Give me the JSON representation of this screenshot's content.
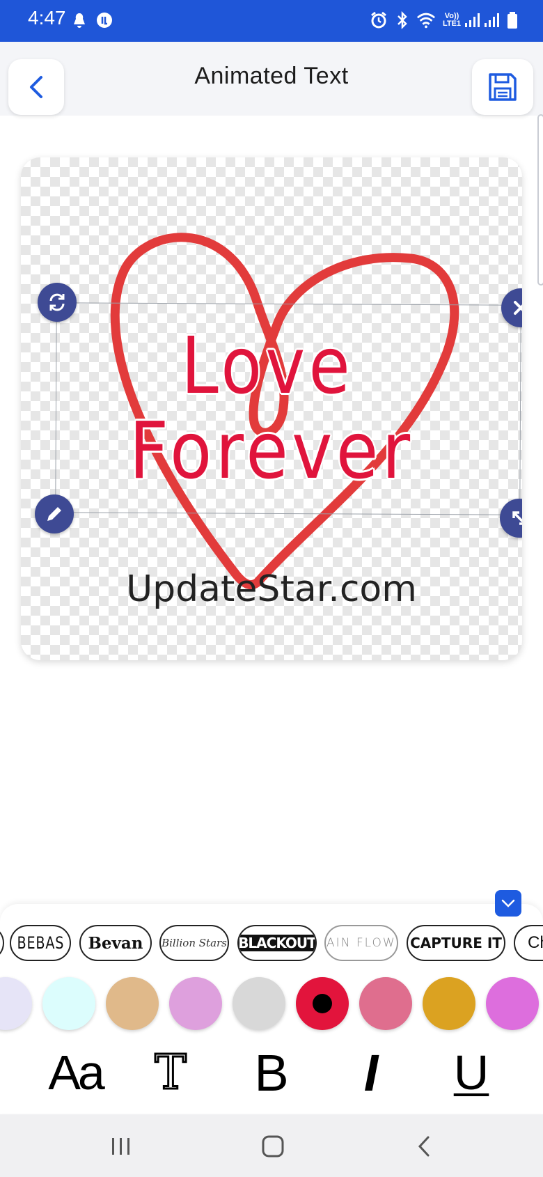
{
  "status_bar": {
    "time": "4:47",
    "network_label_top": "Vo))",
    "network_label_bottom": "LTE1",
    "icons": [
      "notification-icon",
      "messenger-icon",
      "alarm-icon",
      "bluetooth-icon",
      "wifi-icon",
      "signal-icon",
      "signal-icon",
      "battery-icon"
    ]
  },
  "header": {
    "title": "Animated Text",
    "back_icon": "chevron-left-icon",
    "save_icon": "floppy-disk-icon"
  },
  "canvas": {
    "text_line1": "Love",
    "text_line2": "Forever",
    "text_color": "#e0143c",
    "heart_color": "#e23b3b",
    "watermark": "UpdateStar.com",
    "handle_color": "#3e4a94"
  },
  "fonts": [
    {
      "label": "BEBAS"
    },
    {
      "label": "Bevan"
    },
    {
      "label": "Billion Stars"
    },
    {
      "label": "BLACKOUT"
    },
    {
      "label": "BRAIN FLOWER"
    },
    {
      "label": "CAPTURE IT"
    },
    {
      "label": "Chi"
    }
  ],
  "colors": [
    "#e6e4f7",
    "#dcfdfd",
    "#e0b98a",
    "#dea0dd",
    "#d8d8d8",
    "#e2143c",
    "#df6e8e",
    "#dba221",
    "#dd6edd",
    "#e7b9e6"
  ],
  "selected_color_index": 5,
  "format_tools": {
    "font": "Aa",
    "text_style": "T",
    "bold": "B",
    "italic": "I",
    "underline": "U"
  },
  "nav": [
    "recent-apps-icon",
    "home-icon",
    "back-icon"
  ]
}
